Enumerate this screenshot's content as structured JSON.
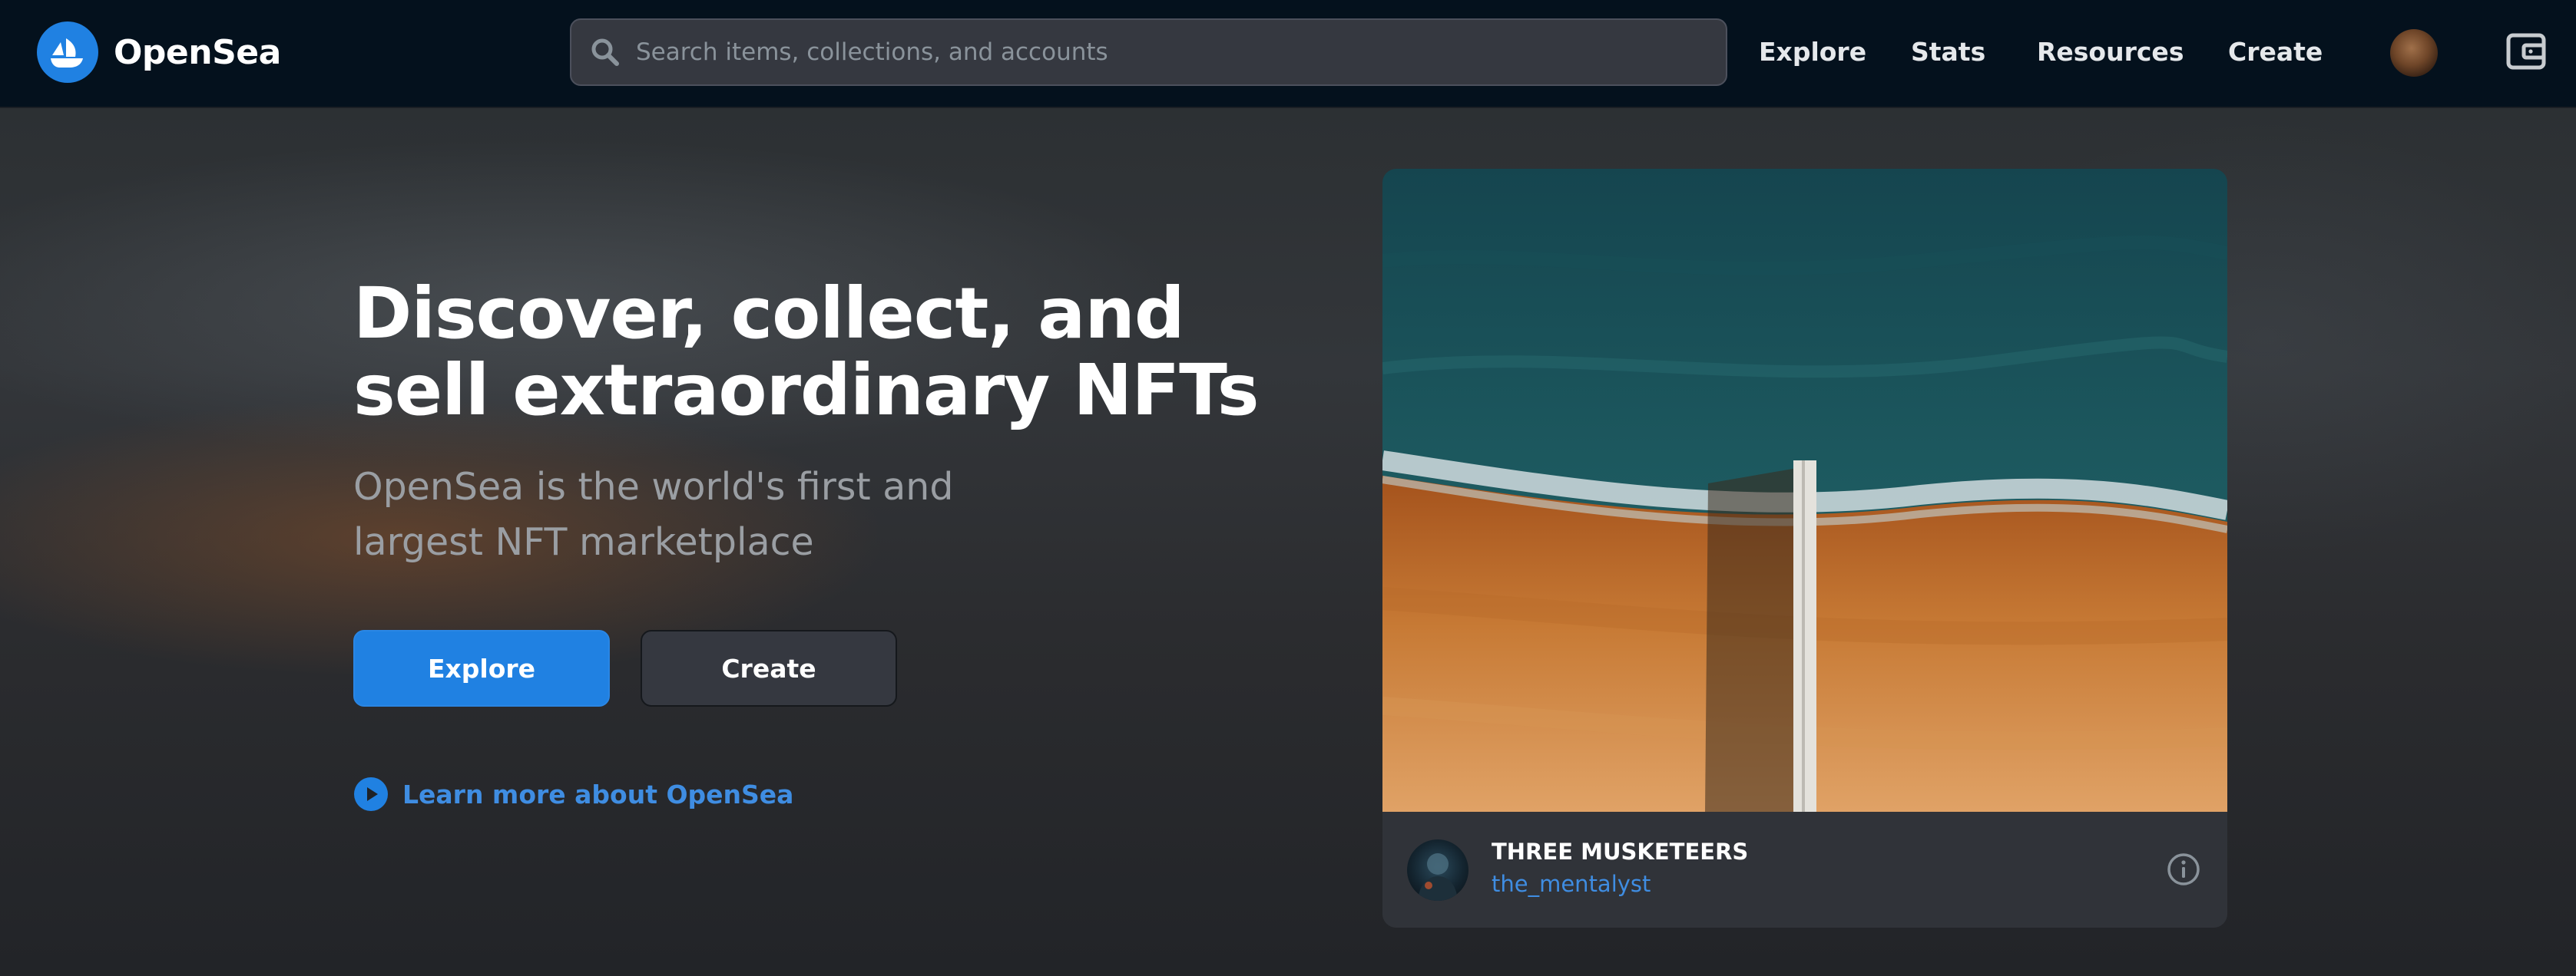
{
  "header": {
    "brand_name": "OpenSea",
    "search_placeholder": "Search items, collections, and accounts",
    "nav": {
      "explore": "Explore",
      "stats": "Stats",
      "resources": "Resources",
      "create": "Create"
    },
    "icons": [
      "opensea-logo-icon",
      "search-icon",
      "profile-avatar",
      "wallet-icon"
    ]
  },
  "hero": {
    "headline": "Discover, collect, and sell extraordinary NFTs",
    "subtitle": "OpenSea is the world's first and largest NFT marketplace",
    "explore_button": "Explore",
    "create_button": "Create",
    "learn_more": "Learn more about OpenSea"
  },
  "featured": {
    "title": "THREE MUSKETEERS",
    "creator": "the_mentalyst",
    "icons": [
      "info-icon"
    ]
  },
  "colors": {
    "brand_blue": "#2081e2",
    "header_bg": "#04111d",
    "card_bg": "#303339",
    "link_blue": "#3f8de2"
  }
}
